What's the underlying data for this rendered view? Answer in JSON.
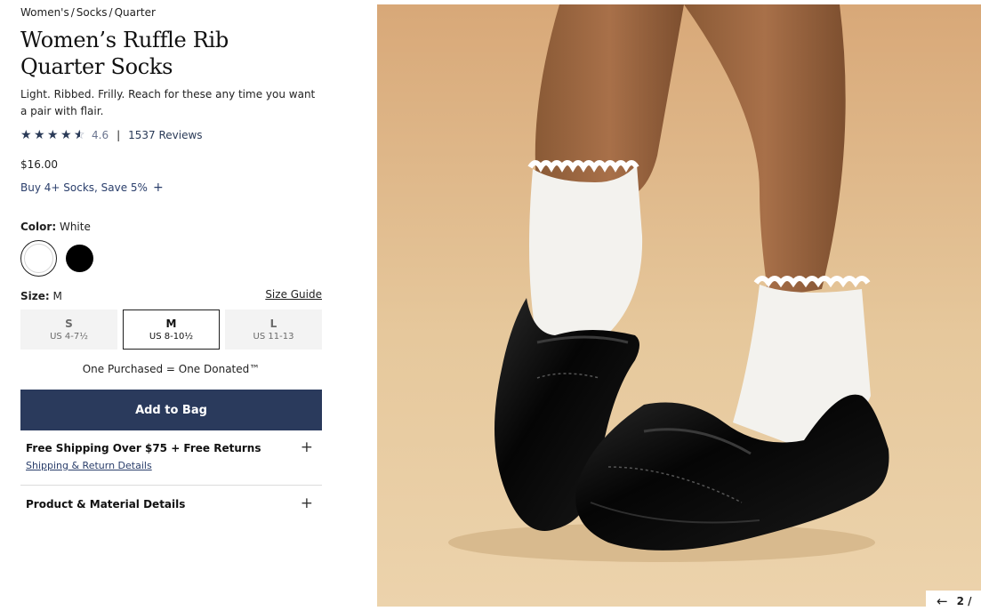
{
  "breadcrumb": {
    "items": [
      "Women's",
      "Socks",
      "Quarter"
    ],
    "separator": "/"
  },
  "product": {
    "title": "Women’s Ruffle Rib Quarter Socks",
    "description": "Light. Ribbed. Frilly. Reach for these any time you want a pair with flair.",
    "rating_value": "4.6",
    "rating": 4.6,
    "rating_divider": "|",
    "reviews": "1537 Reviews",
    "price": "$16.00",
    "promo": "Buy 4+ Socks, Save 5%",
    "promo_icon": "+"
  },
  "color": {
    "label": "Color:",
    "selected": "White",
    "options": [
      {
        "name": "White",
        "hex": "#ffffff"
      },
      {
        "name": "Black",
        "hex": "#000000"
      }
    ]
  },
  "size": {
    "label": "Size:",
    "selected": "M",
    "guide": "Size Guide",
    "options": [
      {
        "name": "S",
        "range": "US 4-7½"
      },
      {
        "name": "M",
        "range": "US 8-10½"
      },
      {
        "name": "L",
        "range": "US 11-13"
      }
    ]
  },
  "donation_note": "One Purchased = One Donated™",
  "add_to_bag": "Add to Bag",
  "accordions": [
    {
      "title": "Free Shipping Over $75 + Free Returns",
      "link": "Shipping & Return Details",
      "icon": "+"
    },
    {
      "title": "Product & Material Details",
      "icon": "+"
    }
  ],
  "gallery": {
    "current": "2",
    "separator": "/",
    "prev_icon": "←"
  },
  "colors": {
    "accent": "#2a3a5c",
    "link": "#2a3e6b",
    "photo_bg": "#e9cfa5"
  }
}
